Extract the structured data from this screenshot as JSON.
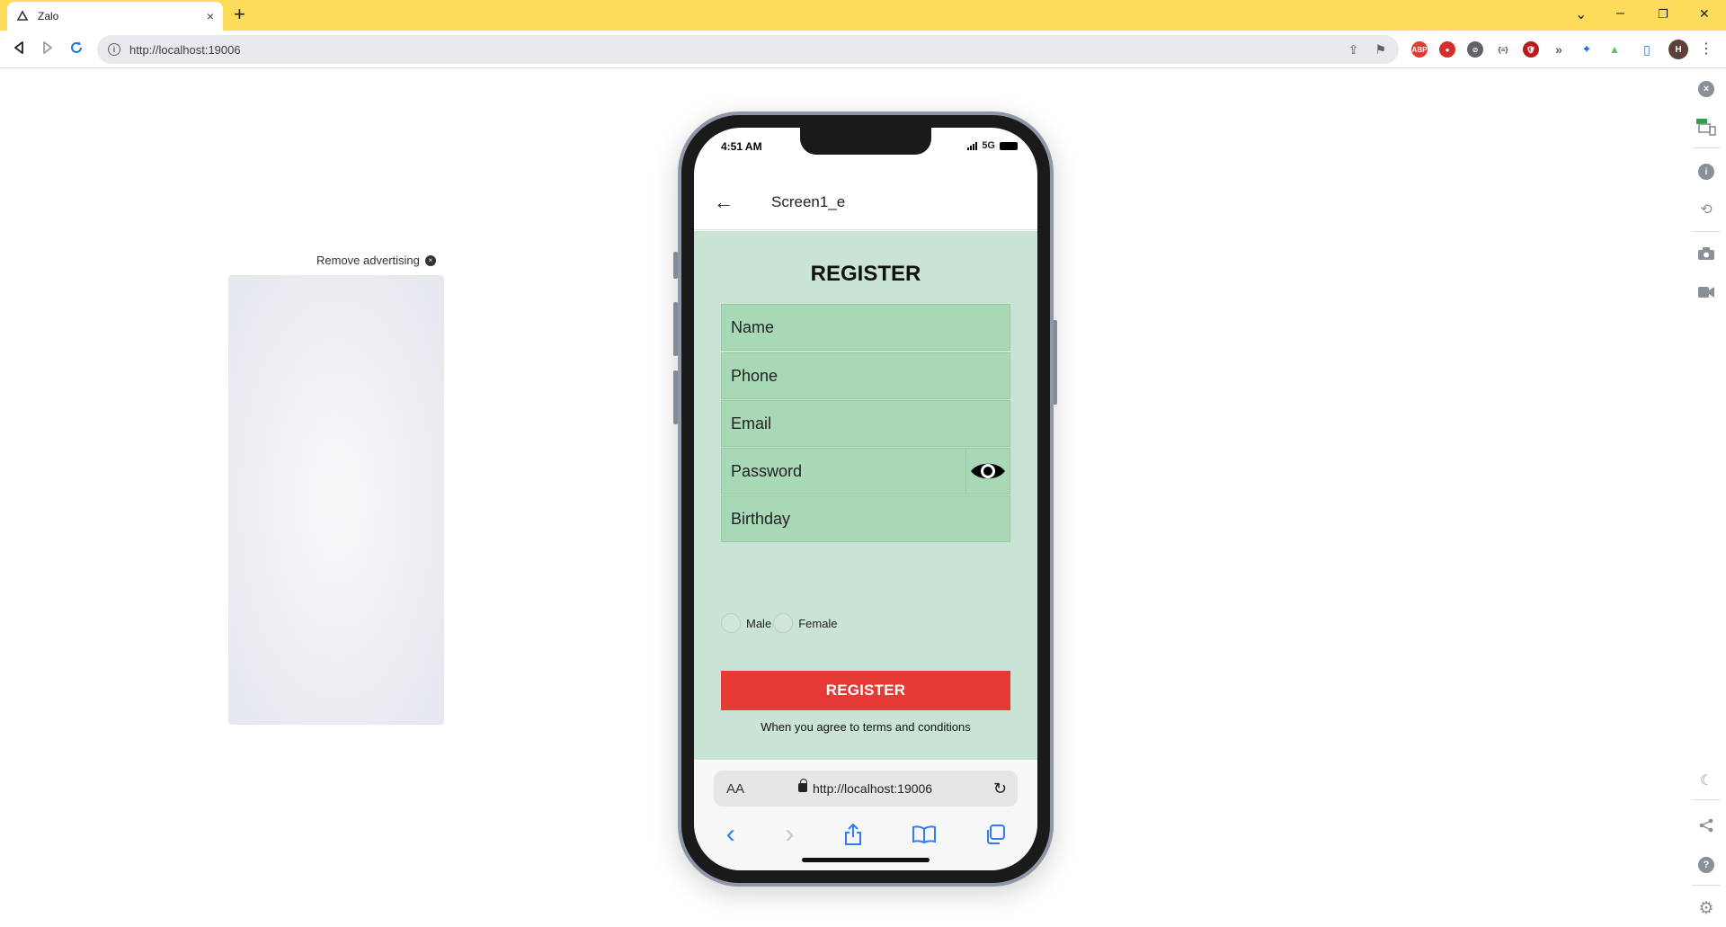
{
  "browser": {
    "tab_title": "Zalo",
    "new_tab": "+",
    "tab_close": "×",
    "url": "http://localhost:19006",
    "window_controls": {
      "minimize": "–",
      "restore": "❐",
      "close": "✕",
      "tabs_menu": "⌄"
    },
    "profile_initial": "H",
    "extensions": [
      "ABP",
      "●",
      "⊘",
      "{≡}",
      "🛡",
      "»",
      "✦",
      "▲",
      "▯"
    ]
  },
  "ad": {
    "remove_label": "Remove advertising",
    "remove_icon": "×"
  },
  "phone": {
    "status": {
      "time": "4:51 AM",
      "network": "5G"
    },
    "app_bar": {
      "back_icon": "←",
      "title": "Screen1_e"
    },
    "form": {
      "heading": "REGISTER",
      "fields": {
        "name": "Name",
        "phone": "Phone",
        "email": "Email",
        "password": "Password",
        "birthday": "Birthday"
      },
      "gender": {
        "male": "Male",
        "female": "Female"
      },
      "submit_label": "REGISTER",
      "terms_text": "When you agree to terms and conditions",
      "colors": {
        "background": "#c9e4d4",
        "field": "#a8d8b6",
        "button": "#e53935"
      }
    },
    "safari": {
      "aa_label": "AA",
      "url": "http://localhost:19006",
      "reload_icon": "↻",
      "nav": {
        "back": "‹",
        "forward": "›",
        "share": "⇪",
        "bookmarks": "📖",
        "tabs": "⧉"
      }
    }
  },
  "side_panel": {
    "icons": [
      "close-icon",
      "devices-icon",
      "info-icon",
      "rotate-icon",
      "camera-icon",
      "video-icon",
      "moon-icon",
      "share-icon",
      "help-icon",
      "settings-icon"
    ]
  }
}
